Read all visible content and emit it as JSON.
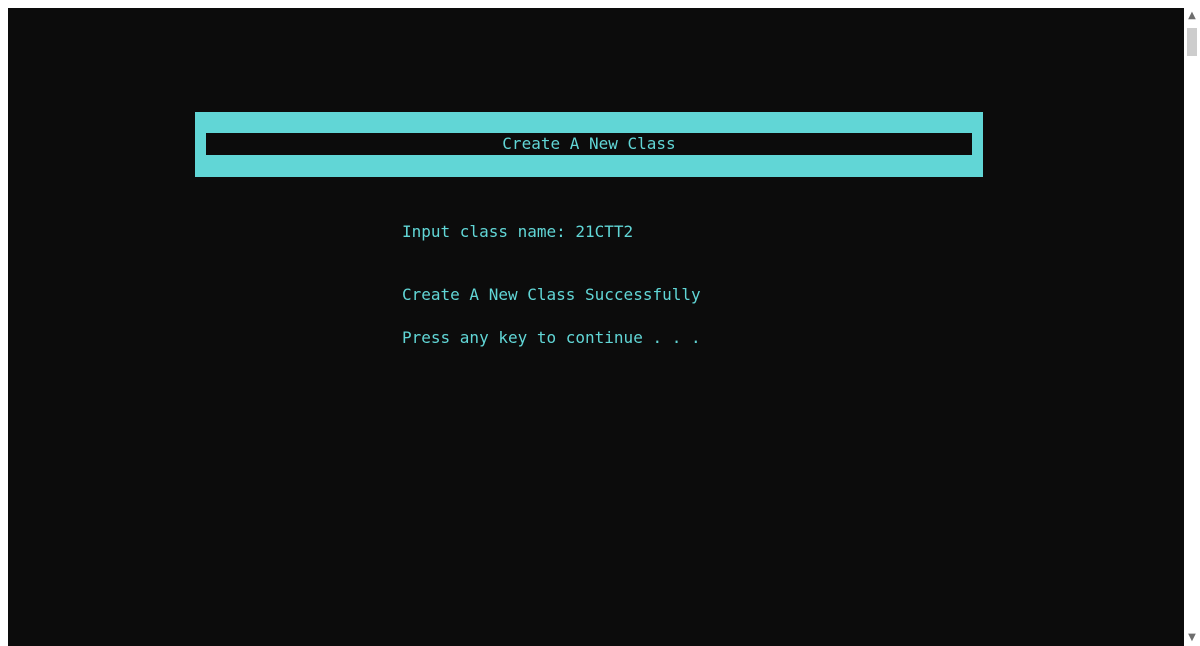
{
  "console": {
    "banner_title": "Create A New Class",
    "prompt_label": "Input class name: ",
    "prompt_value": "21CTT2",
    "success_message": "Create A New Class Successfully",
    "continue_message": "Press any key to continue . . ."
  },
  "scrollbar": {
    "up_icon": "▲",
    "down_icon": "▼"
  },
  "colors": {
    "console_background": "#0c0c0c",
    "console_text": "#61d6d6",
    "banner_fill": "#61d6d6"
  }
}
